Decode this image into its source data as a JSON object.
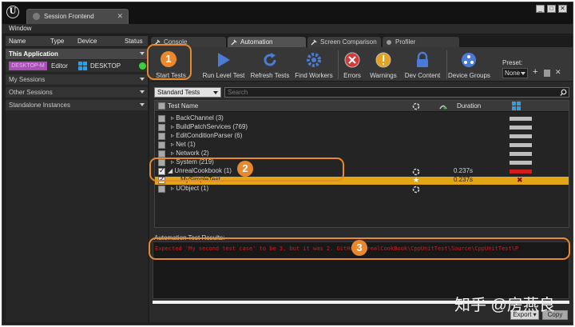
{
  "window": {
    "tab_title": "Session Frontend",
    "menu": [
      "Window"
    ],
    "controls": [
      "_",
      "□",
      "✕"
    ]
  },
  "sessions_panel": {
    "columns": [
      "Name",
      "Type",
      "Device",
      "Status"
    ],
    "sections": [
      {
        "label": "This Application"
      },
      {
        "label": "My Sessions"
      },
      {
        "label": "Other Sessions"
      },
      {
        "label": "Standalone Instances"
      }
    ],
    "instance": {
      "name": "DESKTOP-M",
      "type": "Editor",
      "device": "DESKTOP",
      "status_color": "#3ccf3c"
    }
  },
  "tabs": [
    "Console",
    "Automation",
    "Screen Comparison",
    "Profiler"
  ],
  "active_tab": "Automation",
  "toolbar": {
    "buttons": [
      "Start Tests",
      "Run Level Test",
      "Refresh Tests",
      "Find Workers",
      "Errors",
      "Warnings",
      "Dev Content",
      "Device Groups"
    ],
    "preset_label": "Preset:",
    "preset_value": "None"
  },
  "filter": {
    "dropdown": "Standard Tests",
    "search_placeholder": "Search"
  },
  "test_list": {
    "columns": {
      "name": "Test Name",
      "duration": "Duration"
    },
    "rows": [
      {
        "name": "BackChannel (3)",
        "duration": "",
        "status": "idle"
      },
      {
        "name": "BuildPatchServices (769)",
        "duration": "",
        "status": "idle"
      },
      {
        "name": "EditConditionParser (6)",
        "duration": "",
        "status": "idle"
      },
      {
        "name": "Net (1)",
        "duration": "",
        "status": "idle"
      },
      {
        "name": "Network (2)",
        "duration": "",
        "status": "idle"
      },
      {
        "name": "System (219)",
        "duration": "",
        "status": "idle"
      },
      {
        "name": "UnrealCookbook (1)",
        "duration": "0.237s",
        "status": "failed"
      },
      {
        "name": "MySimpleTest",
        "duration": "0.237s",
        "status": "failed"
      },
      {
        "name": "UObject (1)",
        "duration": "",
        "status": "idle"
      }
    ]
  },
  "results": {
    "label": "Automation Test Results:",
    "message": "Expected 'My second test case' to be 3, but it was 2. GitHub\\UnrealCookBook\\CppUnitTest\\Source\\CppUnitTest\\P",
    "buttons": [
      "Export",
      "Copy"
    ]
  },
  "annotations": [
    "1",
    "2",
    "3"
  ],
  "watermark": "知乎 @房燕良",
  "colors": {
    "accent": "#e1a516",
    "annotation": "#e8892e",
    "error": "#c82020"
  }
}
